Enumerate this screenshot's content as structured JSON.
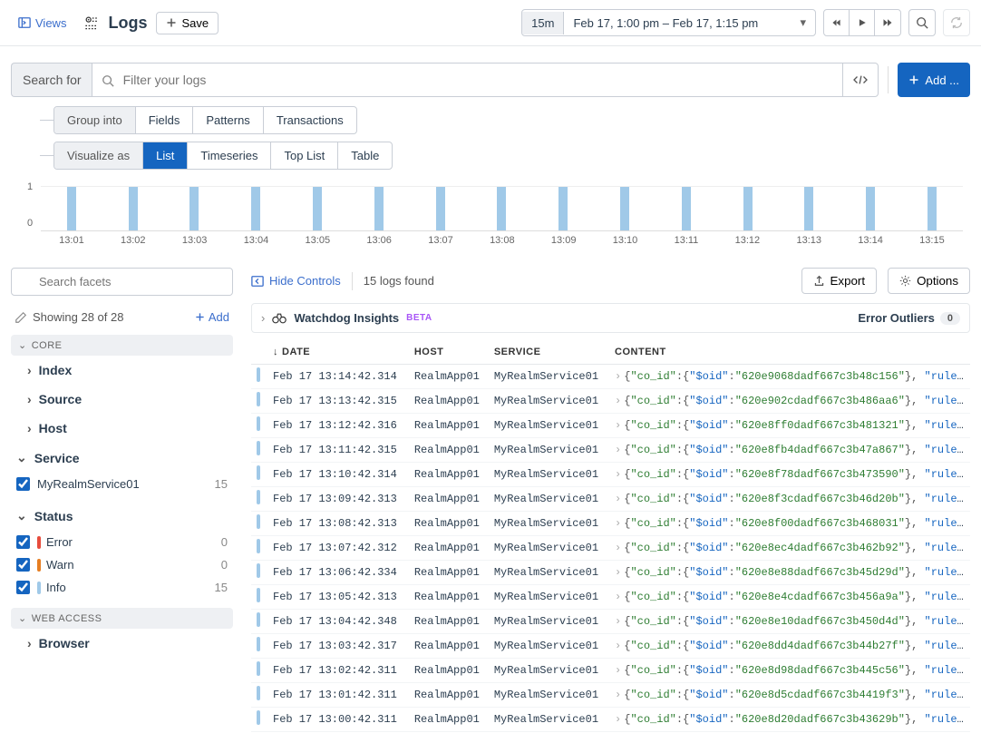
{
  "header": {
    "views_label": "Views",
    "title": "Logs",
    "save_label": "Save",
    "time_badge": "15m",
    "time_range": "Feb 17, 1:00 pm – Feb 17, 1:15 pm"
  },
  "search": {
    "search_for_label": "Search for",
    "placeholder": "Filter your logs",
    "add_label": "Add ..."
  },
  "group_into": {
    "label": "Group into",
    "options": [
      "Fields",
      "Patterns",
      "Transactions"
    ]
  },
  "visualize_as": {
    "label": "Visualize as",
    "options": [
      "List",
      "Timeseries",
      "Top List",
      "Table"
    ],
    "active": "List"
  },
  "chart_data": {
    "type": "bar",
    "categories": [
      "13:01",
      "13:02",
      "13:03",
      "13:04",
      "13:05",
      "13:06",
      "13:07",
      "13:08",
      "13:09",
      "13:10",
      "13:11",
      "13:12",
      "13:13",
      "13:14",
      "13:15"
    ],
    "values": [
      1,
      1,
      1,
      1,
      1,
      1,
      1,
      1,
      1,
      1,
      1,
      1,
      1,
      1,
      1
    ],
    "ylabel": "",
    "xlabel": "",
    "ylim": [
      0,
      1
    ]
  },
  "facets": {
    "search_placeholder": "Search facets",
    "showing_label": "Showing 28 of 28",
    "add_label": "Add",
    "sections": {
      "core_label": "CORE",
      "web_access_label": "WEB ACCESS"
    },
    "core": [
      "Index",
      "Source",
      "Host"
    ],
    "service": {
      "label": "Service",
      "values": [
        {
          "name": "MyRealmService01",
          "count": 15,
          "checked": true
        }
      ]
    },
    "status": {
      "label": "Status",
      "values": [
        {
          "name": "Error",
          "count": 0,
          "checked": true,
          "color": "error"
        },
        {
          "name": "Warn",
          "count": 0,
          "checked": true,
          "color": "warn"
        },
        {
          "name": "Info",
          "count": 15,
          "checked": true,
          "color": "info"
        }
      ]
    },
    "browser_label": "Browser"
  },
  "content": {
    "hide_controls_label": "Hide Controls",
    "logs_found_label": "15 logs found",
    "export_label": "Export",
    "options_label": "Options",
    "insights": {
      "title": "Watchdog Insights",
      "beta": "BETA",
      "outliers_label": "Error Outliers",
      "outliers_count": "0"
    },
    "columns": [
      "DATE",
      "HOST",
      "SERVICE",
      "CONTENT"
    ],
    "rows": [
      {
        "date": "Feb 17 13:14:42.314",
        "host": "RealmApp01",
        "service": "MyRealmService01",
        "oid": "620e9068dadf667c3b48c156"
      },
      {
        "date": "Feb 17 13:13:42.315",
        "host": "RealmApp01",
        "service": "MyRealmService01",
        "oid": "620e902cdadf667c3b486aa6"
      },
      {
        "date": "Feb 17 13:12:42.316",
        "host": "RealmApp01",
        "service": "MyRealmService01",
        "oid": "620e8ff0dadf667c3b481321"
      },
      {
        "date": "Feb 17 13:11:42.315",
        "host": "RealmApp01",
        "service": "MyRealmService01",
        "oid": "620e8fb4dadf667c3b47a867"
      },
      {
        "date": "Feb 17 13:10:42.314",
        "host": "RealmApp01",
        "service": "MyRealmService01",
        "oid": "620e8f78dadf667c3b473590"
      },
      {
        "date": "Feb 17 13:09:42.313",
        "host": "RealmApp01",
        "service": "MyRealmService01",
        "oid": "620e8f3cdadf667c3b46d20b"
      },
      {
        "date": "Feb 17 13:08:42.313",
        "host": "RealmApp01",
        "service": "MyRealmService01",
        "oid": "620e8f00dadf667c3b468031"
      },
      {
        "date": "Feb 17 13:07:42.312",
        "host": "RealmApp01",
        "service": "MyRealmService01",
        "oid": "620e8ec4dadf667c3b462b92"
      },
      {
        "date": "Feb 17 13:06:42.334",
        "host": "RealmApp01",
        "service": "MyRealmService01",
        "oid": "620e8e88dadf667c3b45d29d"
      },
      {
        "date": "Feb 17 13:05:42.313",
        "host": "RealmApp01",
        "service": "MyRealmService01",
        "oid": "620e8e4cdadf667c3b456a9a"
      },
      {
        "date": "Feb 17 13:04:42.348",
        "host": "RealmApp01",
        "service": "MyRealmService01",
        "oid": "620e8e10dadf667c3b450d4d"
      },
      {
        "date": "Feb 17 13:03:42.317",
        "host": "RealmApp01",
        "service": "MyRealmService01",
        "oid": "620e8dd4dadf667c3b44b27f"
      },
      {
        "date": "Feb 17 13:02:42.311",
        "host": "RealmApp01",
        "service": "MyRealmService01",
        "oid": "620e8d98dadf667c3b445c56"
      },
      {
        "date": "Feb 17 13:01:42.311",
        "host": "RealmApp01",
        "service": "MyRealmService01",
        "oid": "620e8d5cdadf667c3b4419f3"
      },
      {
        "date": "Feb 17 13:00:42.311",
        "host": "RealmApp01",
        "service": "MyRealmService01",
        "oid": "620e8d20dadf667c3b43629b"
      }
    ],
    "content_prefix_key": "co_id",
    "content_oid_key": "$oid",
    "content_suffix_key": "rule_metr…"
  }
}
